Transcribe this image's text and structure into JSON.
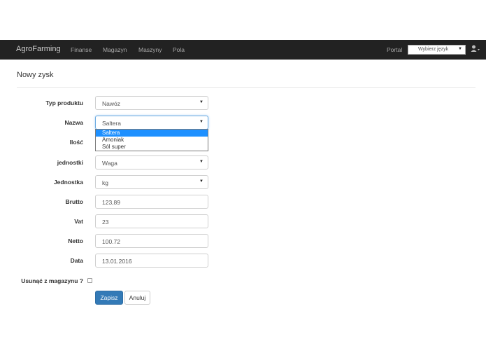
{
  "navbar": {
    "brand": "AgroFarming",
    "links": [
      "Finanse",
      "Magazyn",
      "Maszyny",
      "Pola"
    ],
    "portal": "Portal",
    "language_select": "Wybierz język",
    "user_icon": "user-icon"
  },
  "page": {
    "title": "Nowy zysk"
  },
  "form": {
    "typ_produktu": {
      "label": "Typ produktu",
      "value": "Nawóz"
    },
    "nazwa": {
      "label": "Nazwa",
      "value": "Saltera",
      "options": [
        "Saltera",
        "Amoniak",
        "Sól super"
      ],
      "highlighted": "Saltera"
    },
    "ilosc": {
      "label": "Ilość"
    },
    "jednostki": {
      "label": "jednostki",
      "value": "Waga"
    },
    "jednostka": {
      "label": "Jednostka",
      "value": "kg"
    },
    "brutto": {
      "label": "Brutto",
      "value": "123,89"
    },
    "vat": {
      "label": "Vat",
      "value": "23"
    },
    "netto": {
      "label": "Netto",
      "value": "100.72"
    },
    "data": {
      "label": "Data",
      "value": "13.01.2016"
    },
    "usun": {
      "label": "Usunąć z magazynu ?",
      "checked": false
    }
  },
  "buttons": {
    "save": "Zapisz",
    "cancel": "Anuluj"
  },
  "colors": {
    "navbar_bg": "#222222",
    "primary": "#337ab7",
    "dropdown_highlight": "#1e90ff"
  }
}
